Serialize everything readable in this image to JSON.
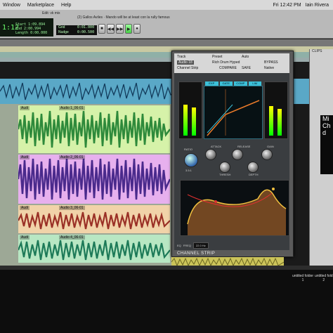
{
  "menubar": {
    "items": [
      "Window",
      "Marketplace",
      "Help"
    ],
    "clock": "Fri 12:42 PM",
    "user": "Iain Rivera"
  },
  "session": {
    "title": "Edit: vk mix",
    "window_title": "(2) Gallos Aviles · Mando will be at least con la rully famous"
  },
  "counter": {
    "main": "1:12",
    "labels": [
      "Start",
      "End",
      "Length"
    ],
    "values": [
      "1:09.894",
      "2:00.994",
      "0:00.000"
    ],
    "grid_label": "Grid",
    "nudge_label": "Nudge",
    "grid_value": "0:01.000",
    "nudge_value": "0:00.500"
  },
  "transport": {
    "buttons": [
      "■",
      "◀◀",
      "▶▶",
      "▶",
      "●"
    ]
  },
  "regions": [
    {
      "name": "Audi",
      "clip": "Audio 1_06-01"
    },
    {
      "name": "Audi",
      "clip": "Audio 2_06-01"
    },
    {
      "name": "Audi",
      "clip": "Audio 3_06-01"
    },
    {
      "name": "Audi",
      "clip": "Audio 4_06-01"
    }
  ],
  "plugin": {
    "tabs": [
      "Track",
      "Preset",
      "Auto"
    ],
    "track": "Audio 18",
    "preset_name": "Rich Drum Hyped",
    "channel_strip": "Channel Strip",
    "compare": "COMPARE",
    "safe": "SAFE",
    "bypass": "BYPASS",
    "native": "Native",
    "dyn_tabs": [
      "EXP",
      "GATE",
      "COMP",
      "LIM"
    ],
    "knobs": [
      "RATIO",
      "ATTACK",
      "RELEASE",
      "GAIN",
      "THRESH",
      "DEPTH"
    ],
    "ratio_value": "3.5:1",
    "footer": [
      "EQ",
      "FREQ",
      "22.0 Hz"
    ],
    "strip_label": "CHANNEL STRIP"
  },
  "clips": {
    "header": "CLIPS",
    "hud": [
      "Mi",
      "Ch",
      "d"
    ]
  },
  "desktop": {
    "folder1": "untitled folder",
    "folder2": "untitled fold",
    "folder1_num": "1",
    "folder2_num": "2"
  },
  "colors": {
    "waveform_green": "#2e8a3b",
    "waveform_purple": "#4a2a8c",
    "waveform_red": "#9a3026",
    "waveform_teal": "#1d7a58",
    "track_blue": "#5aa8c7",
    "accent_cyan": "#3cc1d9"
  }
}
